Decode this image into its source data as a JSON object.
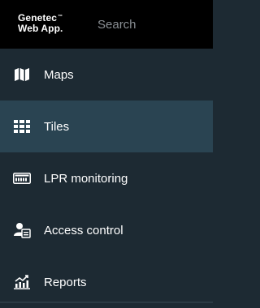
{
  "app": {
    "logo_line1": "Genetec",
    "logo_tm": "™",
    "logo_line2": "Web App."
  },
  "search": {
    "placeholder": "Search"
  },
  "nav": {
    "items": [
      {
        "label": "Maps",
        "icon": "map-icon",
        "active": false
      },
      {
        "label": "Tiles",
        "icon": "tiles-grid-icon",
        "active": true
      },
      {
        "label": "LPR monitoring",
        "icon": "license-plate-icon",
        "active": false
      },
      {
        "label": "Access control",
        "icon": "access-control-icon",
        "active": false
      },
      {
        "label": "Reports",
        "icon": "reports-chart-icon",
        "active": false
      }
    ]
  },
  "colors": {
    "topbar": "#000000",
    "sidebar": "#1d2a33",
    "active_item": "#2a4452",
    "placeholder": "#8a8f94",
    "text": "#ffffff"
  }
}
